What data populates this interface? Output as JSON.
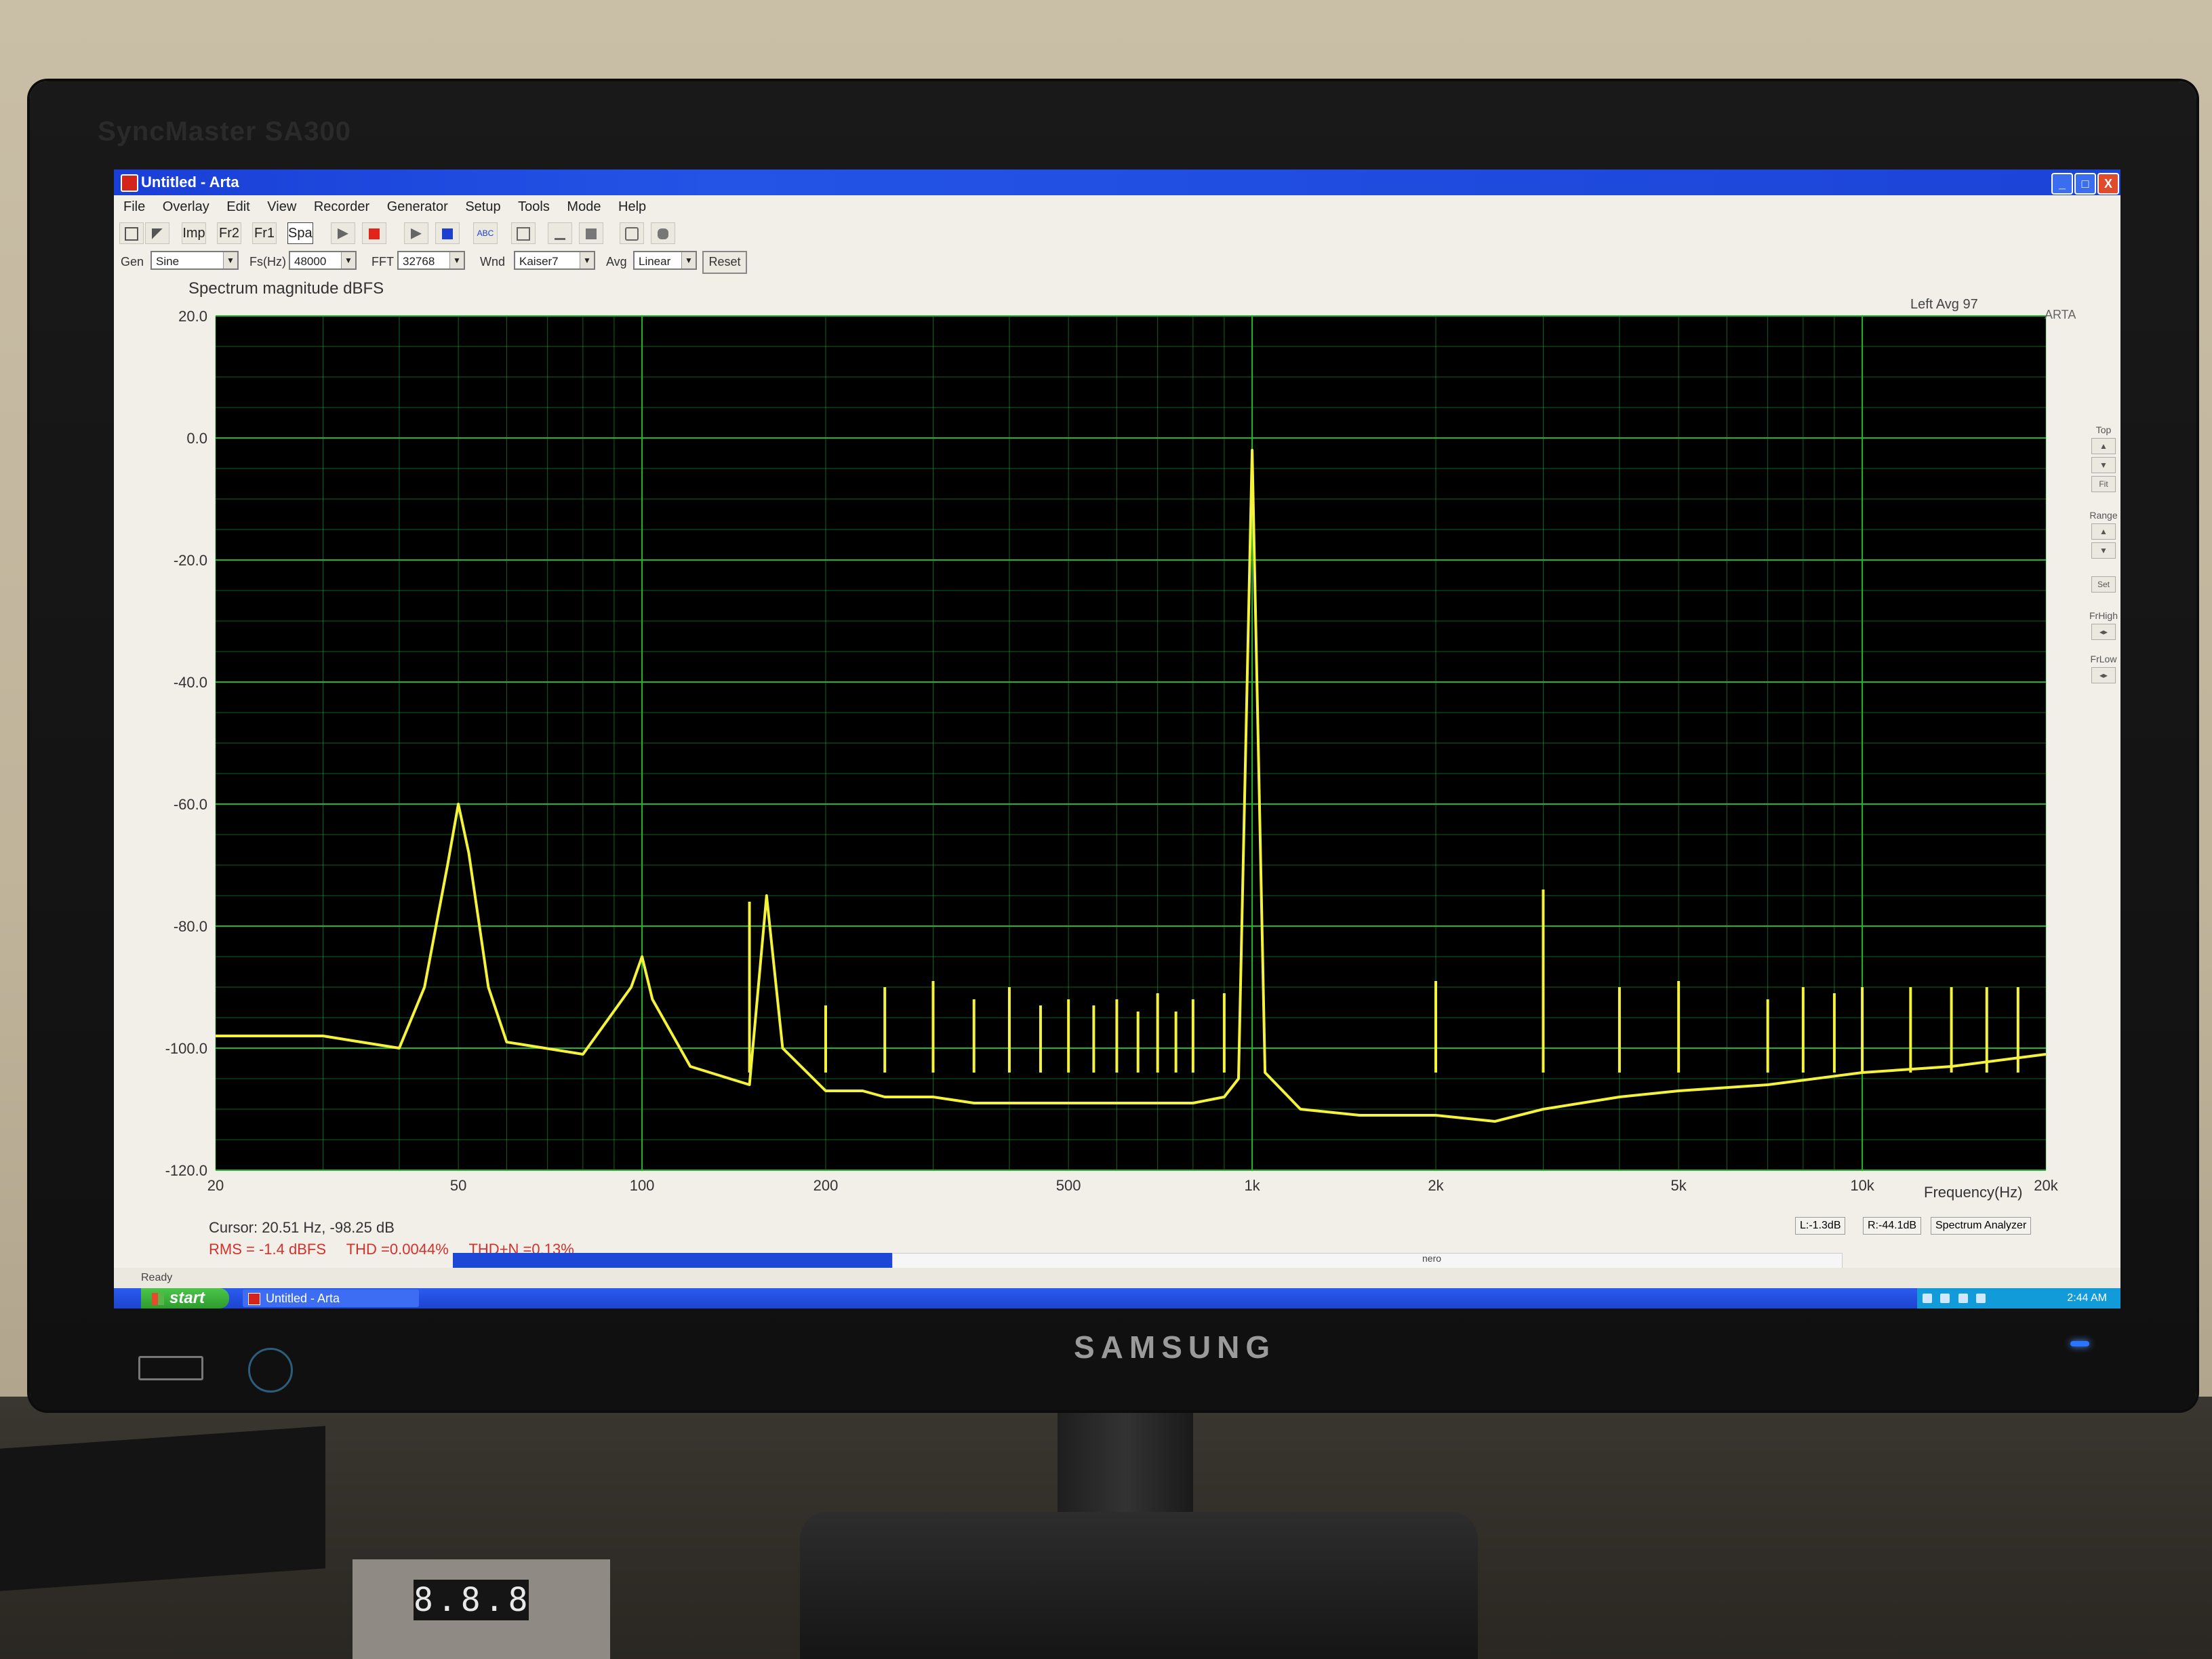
{
  "monitor": {
    "model": "SyncMaster SA300",
    "brand": "SAMSUNG"
  },
  "window": {
    "title": "Untitled - Arta",
    "buttons": {
      "minimize": "_",
      "maximize": "□",
      "close": "X"
    }
  },
  "menu": [
    "File",
    "Overlay",
    "Edit",
    "View",
    "Recorder",
    "Generator",
    "Setup",
    "Tools",
    "Mode",
    "Help"
  ],
  "toolbar": {
    "imp": "Imp",
    "fr2": "Fr2",
    "fr1": "Fr1",
    "spa": "Spa",
    "abc": "ABC"
  },
  "options": {
    "gen_label": "Gen",
    "gen_value": "Sine",
    "fs_label": "Fs(Hz)",
    "fs_value": "48000",
    "fft_label": "FFT",
    "fft_value": "32768",
    "wnd_label": "Wnd",
    "wnd_value": "Kaiser7",
    "avg_label": "Avg",
    "avg_value": "Linear",
    "reset_label": "Reset"
  },
  "side_panel": {
    "top_label": "Top",
    "fit_label": "Fit",
    "range_label": "Range",
    "set_label": "Set",
    "frhigh_label": "FrHigh",
    "frlow_label": "FrLow"
  },
  "chart": {
    "corner_text": "Left  Avg 97",
    "arta_vertical": "ARTA",
    "x_unit_label": "Frequency(Hz)",
    "y_tick_labels": [
      "20.0",
      "0.0",
      "-20.0",
      "-40.0",
      "-60.0",
      "-80.0",
      "-100.0",
      "-120.0"
    ],
    "x_tick_labels": [
      "20",
      "50",
      "100",
      "200",
      "500",
      "1k",
      "2k",
      "5k",
      "10k",
      "20k"
    ]
  },
  "colors": {
    "plot_background": "#000000",
    "grid": "#1fb62a",
    "trace": "#f4f23a",
    "measure_text": "#d2322d"
  },
  "chart_data": {
    "type": "line",
    "title": "Spectrum magnitude dBFS",
    "xlabel": "Frequency(Hz)",
    "ylabel": "",
    "x_scale": "log",
    "xlim": [
      20,
      20000
    ],
    "ylim": [
      -120,
      20
    ],
    "grid": true,
    "series": [
      {
        "x": [
          20,
          30,
          40,
          44,
          48,
          50,
          52,
          56,
          60,
          80,
          96,
          100,
          104,
          120,
          150,
          160,
          170,
          200,
          230,
          250,
          300,
          350,
          400,
          450,
          500,
          600,
          700,
          800,
          900,
          950,
          1000,
          1050,
          1200,
          1500,
          2000,
          2500,
          3000,
          4000,
          5000,
          7000,
          10000,
          14000,
          20000
        ],
        "y": [
          -98,
          -98,
          -100,
          -90,
          -70,
          -60,
          -68,
          -90,
          -99,
          -101,
          -90,
          -85,
          -92,
          -103,
          -106,
          -75,
          -100,
          -107,
          -107,
          -108,
          -108,
          -109,
          -109,
          -109,
          -109,
          -109,
          -109,
          -109,
          -108,
          -105,
          -2,
          -104,
          -110,
          -111,
          -111,
          -112,
          -110,
          -108,
          -107,
          -106,
          -104,
          -103,
          -101
        ]
      },
      {
        "x": [
          150,
          200,
          250,
          300,
          350,
          400,
          450,
          500,
          550,
          600,
          650,
          700,
          750,
          800,
          900,
          2000,
          3000,
          4000,
          5000,
          7000,
          8000,
          9000,
          10000,
          12000,
          14000,
          16000,
          18000
        ],
        "y": [
          -76,
          -93,
          -90,
          -89,
          -92,
          -90,
          -93,
          -92,
          -93,
          -92,
          -94,
          -91,
          -94,
          -92,
          -91,
          -89,
          -74,
          -90,
          -89,
          -92,
          -90,
          -91,
          -90,
          -90,
          -90,
          -90,
          -90
        ]
      }
    ]
  },
  "readout": {
    "cursor": "Cursor: 20.51 Hz, -98.25 dB",
    "rms": "RMS =  -1.4 dBFS",
    "thd": "THD =0.0044%",
    "thdn": "THD+N =0.13%"
  },
  "status": {
    "ready": "Ready",
    "left_level": "L:-1.3dB",
    "right_level": "R:-44.1dB",
    "mode": "Spectrum Analyzer",
    "nero": "nero"
  },
  "taskbar": {
    "start": "start",
    "task": "Untitled - Arta",
    "clock": "2:44 AM"
  }
}
